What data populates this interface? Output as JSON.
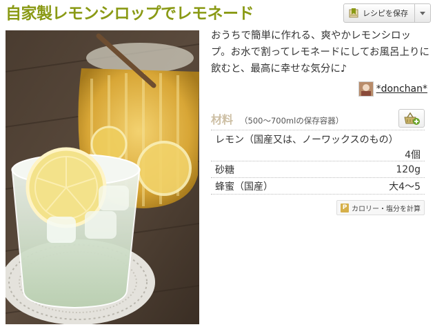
{
  "recipe": {
    "title": "自家製レモンシロップでレモネード",
    "save_label": "レシピを保存",
    "description": "おうちで簡単に作れる、爽やかレモンシロップ。お水で割ってレモネードにしてお風呂上りに飲むと、最高に幸せな気分に♪",
    "author": "*donchan*"
  },
  "ingredients": {
    "title": "材料",
    "note": "（500〜700mlの保存容器）",
    "items": [
      {
        "name": "レモン（国産又は、ノーワックスのもの）",
        "qty": "4個"
      },
      {
        "name": "砂糖",
        "qty": "120g"
      },
      {
        "name": "蜂蜜（国産）",
        "qty": "大4〜5"
      }
    ],
    "calorie_label": "カロリー・塩分を計算",
    "calorie_badge": "P"
  },
  "colors": {
    "title": "#8a9a15",
    "ingredient_heading": "#cdbfa4"
  },
  "icons": {
    "save": "bookmark-save-icon",
    "dropdown": "chevron-down-icon",
    "basket": "basket-add-icon",
    "calorie": "calorie-calculator-icon"
  }
}
